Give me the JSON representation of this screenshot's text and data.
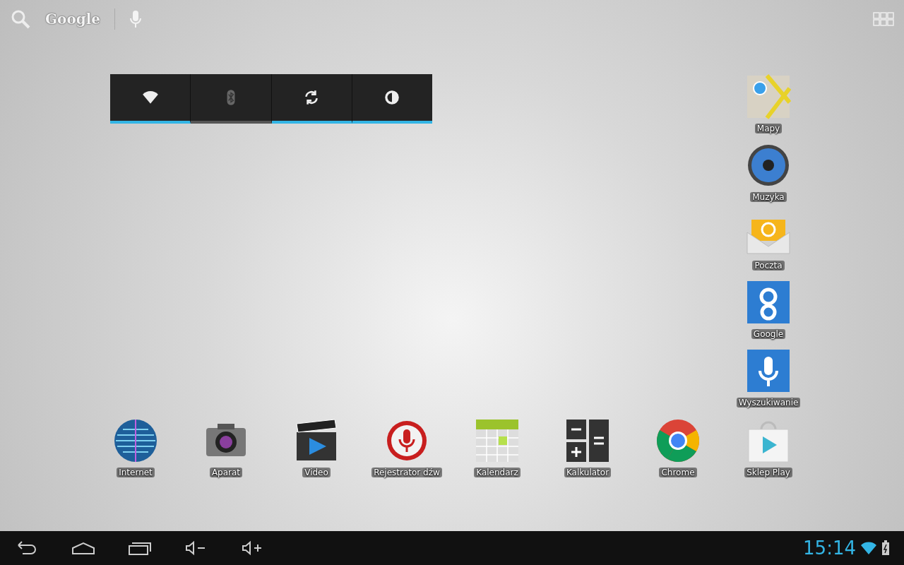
{
  "search_bar": {
    "logo_text": "Google"
  },
  "power_widget": {
    "toggles": [
      {
        "kind": "wifi",
        "on": true
      },
      {
        "kind": "bluetooth",
        "on": false
      },
      {
        "kind": "sync",
        "on": true
      },
      {
        "kind": "brightness",
        "on": true
      }
    ]
  },
  "side_apps": [
    {
      "kind": "maps",
      "label": "Mapy"
    },
    {
      "kind": "music",
      "label": "Muzyka"
    },
    {
      "kind": "mail",
      "label": "Poczta"
    },
    {
      "kind": "google",
      "label": "Google"
    },
    {
      "kind": "voice",
      "label": "Wyszukiwanie"
    }
  ],
  "dock_apps": [
    {
      "kind": "globe",
      "label": "Internet"
    },
    {
      "kind": "camera",
      "label": "Aparat"
    },
    {
      "kind": "video",
      "label": "Video"
    },
    {
      "kind": "recorder",
      "label": "Rejestrator dźw"
    },
    {
      "kind": "calendar",
      "label": "Kalendarz"
    },
    {
      "kind": "calculator",
      "label": "Kalkulator"
    },
    {
      "kind": "chrome",
      "label": "Chrome"
    },
    {
      "kind": "store",
      "label": "Sklep Play"
    }
  ],
  "nav_bar": {
    "clock": "15:14"
  }
}
